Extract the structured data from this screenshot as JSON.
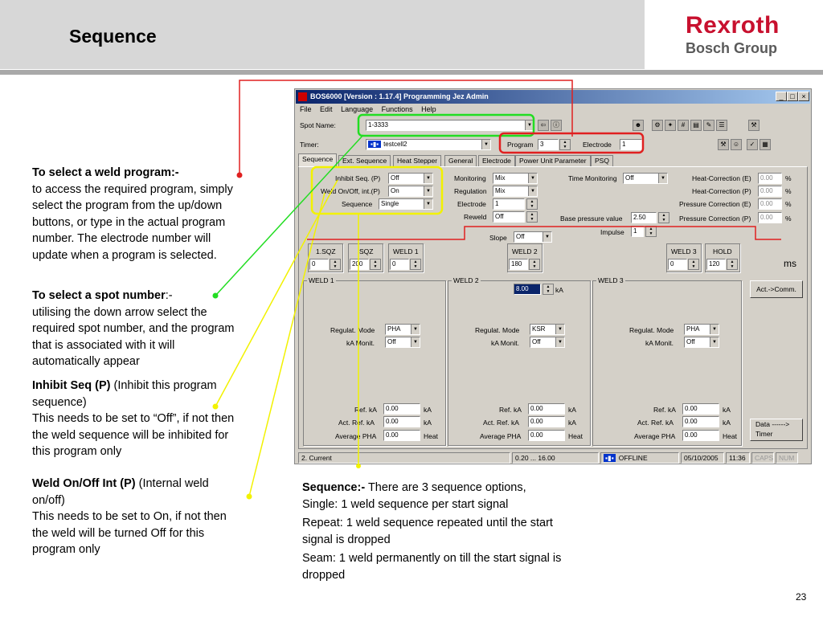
{
  "slide": {
    "title": "Sequence",
    "page_number": "23"
  },
  "logo": {
    "line1": "Rexroth",
    "line2": "Bosch Group",
    "color": "#c8102e"
  },
  "annotations": {
    "weld_program": {
      "heading": "To select a weld program:-",
      "body": "to access the required program, simply select the program from the up/down buttons, or type in the actual program number. The electrode number will update when a program is selected."
    },
    "spot_number": {
      "heading": "To select a spot number",
      "suffix": ":-",
      "body": "utilising the down arrow select the required spot number, and the program that is associated with it will automatically appear"
    },
    "inhibit": {
      "heading": "Inhibit Seq (P)",
      "suffix": " (Inhibit this program sequence)",
      "body": "This needs to be set to “Off”, if not then the weld sequence will be inhibited for this program only"
    },
    "weld_onoff": {
      "heading": "Weld On/Off Int (P)",
      "suffix": " (Internal weld on/off)",
      "body": "This needs to be set to On, if not then the weld will be turned Off for this program only"
    },
    "sequence": {
      "heading": "Sequence:-",
      "line1": " There are 3 sequence options,",
      "line2": "Single: 1 weld sequence per start signal",
      "line3": "Repeat: 1 weld sequence repeated until the start signal is dropped",
      "line4": "Seam: 1 weld permanently on till the start signal is dropped"
    }
  },
  "window": {
    "title": "BOS6000 [Version : 1.17.4] Programming Jez Admin",
    "menu": [
      "File",
      "Edit",
      "Language",
      "Functions",
      "Help"
    ],
    "spot_name_label": "Spot Name:",
    "spot_name_value": "1-3333",
    "timer_label": "Timer:",
    "timer_value": "testcell2",
    "program_label": "Program",
    "program_value": "3",
    "electrode_label": "Electrode",
    "electrode_value": "1",
    "tabs": [
      "Sequence",
      "Ext. Sequence",
      "Heat Stepper",
      "General",
      "Electrode",
      "Power Unit Parameter",
      "PSQ"
    ],
    "col1": {
      "inhibit_label": "Inhibit Seq. (P)",
      "inhibit_value": "Off",
      "weldonoff_label": "Weld On/Off, int.(P)",
      "weldonoff_value": "On",
      "sequence_label": "Sequence",
      "sequence_value": "Single"
    },
    "col2": {
      "monitoring_label": "Monitoring",
      "monitoring_value": "Mix",
      "regulation_label": "Regulation",
      "regulation_value": "Mix",
      "electrode_label": "Electrode",
      "electrode_value": "1",
      "reweld_label": "Reweld",
      "reweld_value": "Off"
    },
    "col3": {
      "time_mon_label": "Time Monitoring",
      "time_mon_value": "Off",
      "base_pressure_label": "Base pressure value",
      "base_pressure_value": "2.50",
      "impulse_label": "Impulse",
      "impulse_value": "1"
    },
    "col4": {
      "heat_e_label": "Heat-Correction (E)",
      "heat_e_value": "0.00",
      "heat_p_label": "Heat-Correction (P)",
      "heat_p_value": "0.00",
      "press_e_label": "Pressure Correction (E)",
      "press_e_value": "0.00",
      "press_p_label": "Pressure Correction (P)",
      "press_p_value": "0.00",
      "unit": "%"
    },
    "slope_label": "Slope",
    "slope_value": "Off",
    "times": {
      "sqz1_label": "1.SQZ",
      "sqz1_value": "0",
      "sqz_label": "SQZ",
      "sqz_value": "200",
      "weld1_label": "WELD 1",
      "weld1_value": "0",
      "weld2_label": "WELD 2",
      "weld2_value": "180",
      "weld3_label": "WELD 3",
      "weld3_value": "0",
      "hold_label": "HOLD",
      "hold_value": "120",
      "unit": "ms"
    },
    "weld1": {
      "title": "WELD 1",
      "regmode_label": "Regulat. Mode",
      "regmode_value": "PHA",
      "kamon_label": "kA Monit.",
      "kamon_value": "Off",
      "refka_label": "Ref. kA",
      "refka_value": "0.00",
      "actref_label": "Act. Ref. kA",
      "actref_value": "0.00",
      "avgpha_label": "Average PHA",
      "avgpha_value": "0.00",
      "ka": "kA",
      "heat": "Heat"
    },
    "weld2": {
      "title": "WELD 2",
      "current_value": "8.00",
      "current_unit": "kA",
      "regmode_label": "Regulat. Mode",
      "regmode_value": "KSR",
      "kamon_label": "kA Monit.",
      "kamon_value": "Off",
      "refka_label": "Ref. kA",
      "refka_value": "0.00",
      "actref_label": "Act. Ref. kA",
      "actref_value": "0.00",
      "avgpha_label": "Average PHA",
      "avgpha_value": "0.00",
      "ka": "kA",
      "heat": "Heat"
    },
    "weld3": {
      "title": "WELD 3",
      "regmode_label": "Regulat. Mode",
      "regmode_value": "PHA",
      "kamon_label": "kA Monit.",
      "kamon_value": "Off",
      "refka_label": "Ref. kA",
      "refka_value": "0.00",
      "actref_label": "Act. Ref. kA",
      "actref_value": "0.00",
      "avgpha_label": "Average PHA",
      "avgpha_value": "0.00",
      "ka": "kA",
      "heat": "Heat"
    },
    "act_comm_button": "Act.->Comm.",
    "data_timer_button": "Data ------> Timer",
    "status": {
      "current": "2. Current",
      "range": "0.20 ... 16.00",
      "offline": "OFFLINE",
      "date": "05/10/2005",
      "time": "11:36",
      "caps": "CAPS",
      "num": "NUM"
    }
  }
}
